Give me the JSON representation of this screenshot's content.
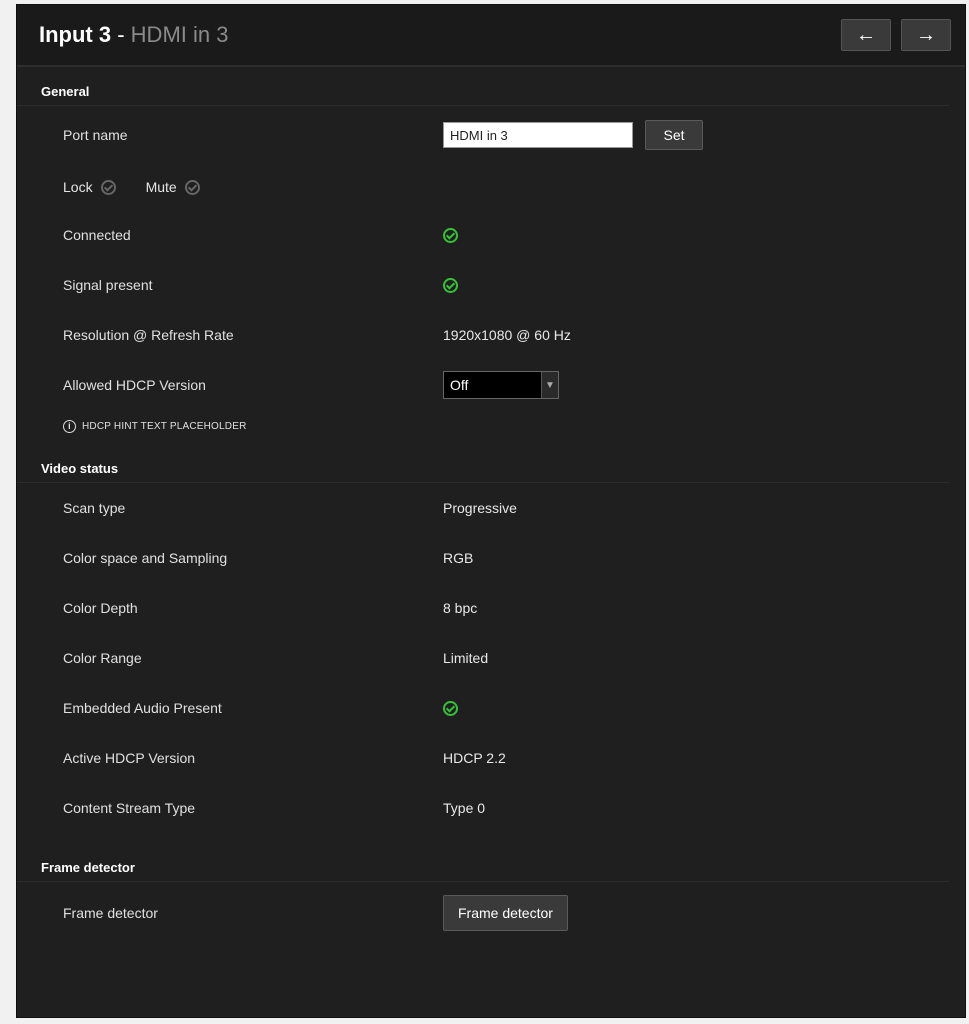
{
  "header": {
    "title_main": "Input 3",
    "title_sep": " - ",
    "title_sub": "HDMI in 3",
    "prev_icon": "arrow-left-icon",
    "next_icon": "arrow-right-icon"
  },
  "general": {
    "section_title": "General",
    "port_name": {
      "label": "Port name",
      "value": "HDMI in 3",
      "button": "Set"
    },
    "lock_label": "Lock",
    "mute_label": "Mute",
    "connected": {
      "label": "Connected"
    },
    "signal_present": {
      "label": "Signal present"
    },
    "resolution": {
      "label": "Resolution @ Refresh Rate",
      "value": "1920x1080 @ 60 Hz"
    },
    "allowed_hdcp": {
      "label": "Allowed HDCP Version",
      "selected": "Off"
    },
    "hint": "HDCP HINT TEXT PLACEHOLDER"
  },
  "video_status": {
    "section_title": "Video status",
    "scan_type": {
      "label": "Scan type",
      "value": "Progressive"
    },
    "color_space": {
      "label": "Color space and Sampling",
      "value": "RGB"
    },
    "color_depth": {
      "label": "Color Depth",
      "value": "8 bpc"
    },
    "color_range": {
      "label": "Color Range",
      "value": "Limited"
    },
    "embedded_audio": {
      "label": "Embedded Audio Present"
    },
    "active_hdcp": {
      "label": "Active HDCP Version",
      "value": "HDCP 2.2"
    },
    "content_stream": {
      "label": "Content Stream Type",
      "value": "Type 0"
    }
  },
  "frame_detector": {
    "section_title": "Frame detector",
    "label": "Frame detector",
    "button": "Frame detector"
  },
  "colors": {
    "status_ok": "#36c236",
    "panel_bg": "#1f1f1f"
  }
}
